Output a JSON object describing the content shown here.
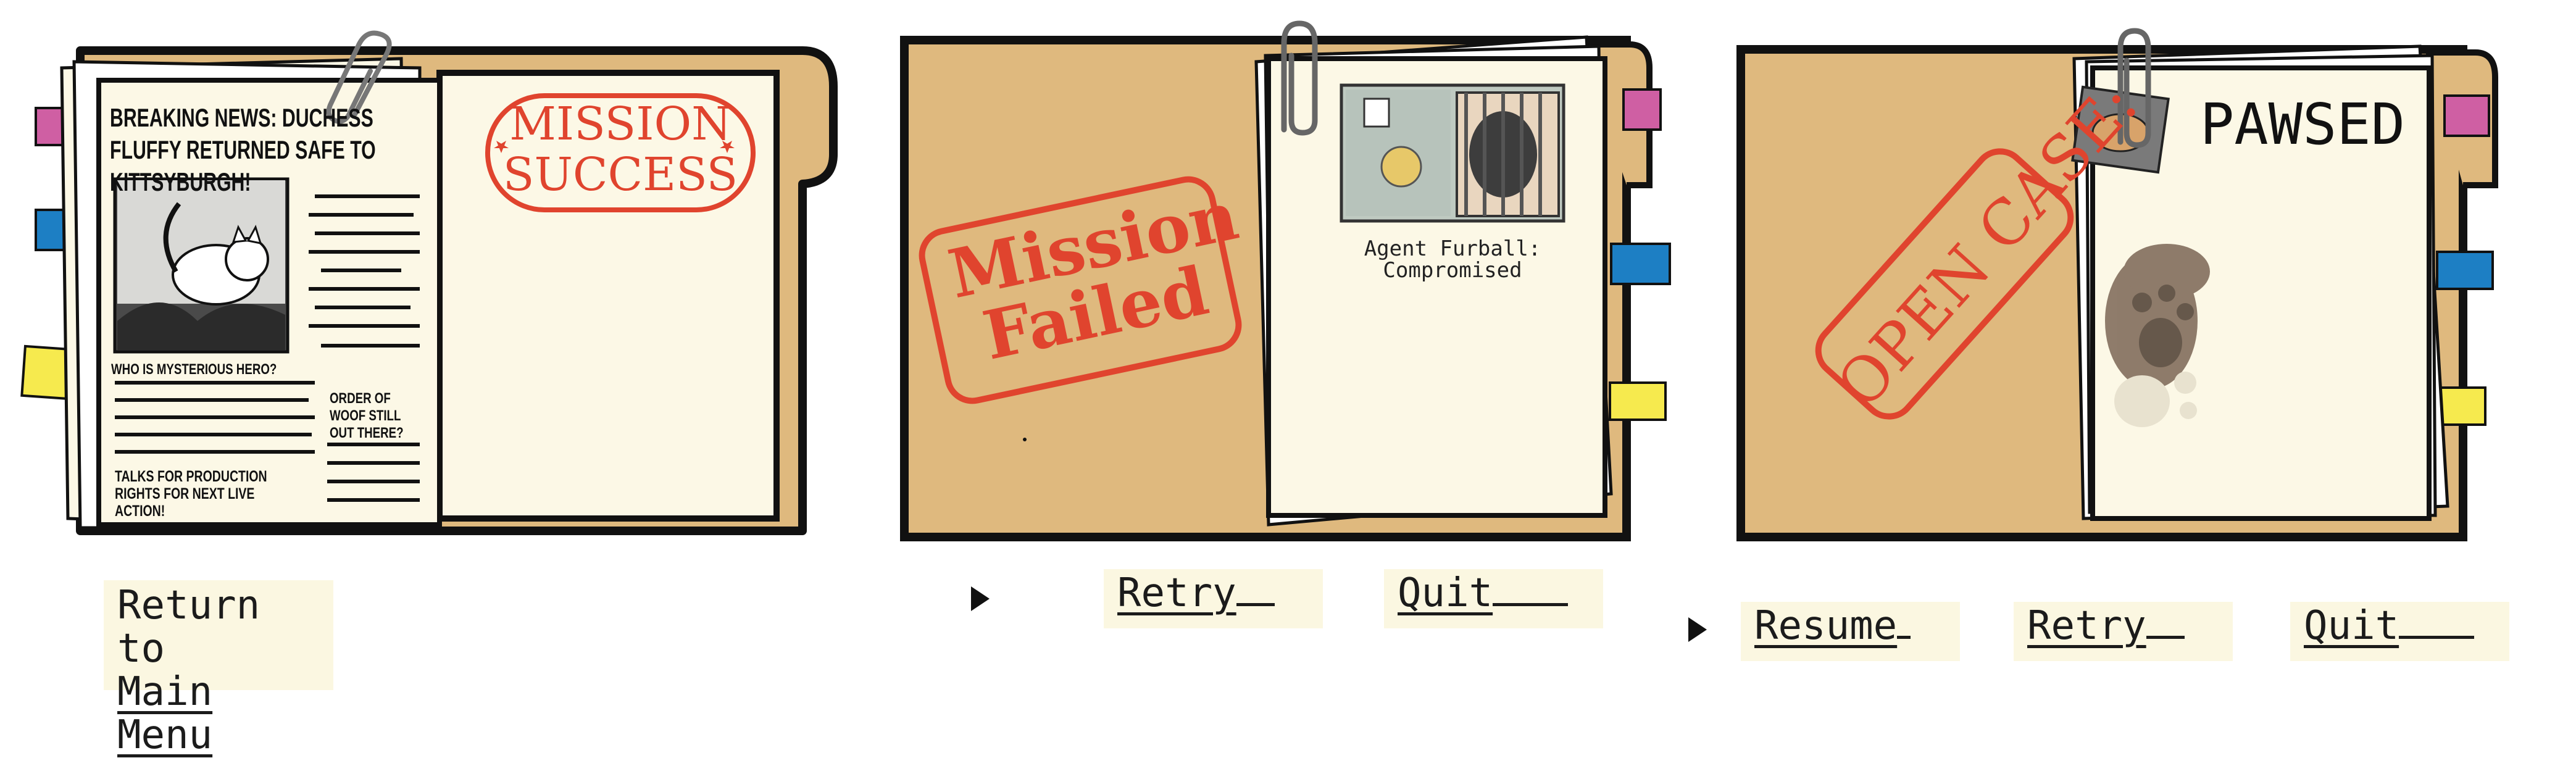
{
  "screen": {
    "success_panel": {
      "headline": "BREAKING NEWS: DUCHESS FLUFFY RETURNED SAFE TO KITTSYBURGH!",
      "sub1": "WHO IS MYSTERIOUS HERO?",
      "sub2": "ORDER OF WOOF STILL OUT THERE?",
      "sub3": "TALKS FOR PRODUCTION RIGHTS FOR NEXT LIVE ACTION!",
      "stamp_line1": "MISSION",
      "stamp_line2": "SUCCESS",
      "button_line1": "Return to",
      "button_line2": "Main Menu"
    },
    "failed_panel": {
      "stamp_line1": "Mission",
      "stamp_line2": "Failed",
      "caption_line1": "Agent Furball:",
      "caption_line2": "Compromised",
      "retry_label": "Retry",
      "quit_label": "Quit"
    },
    "paused_panel": {
      "title": "PAWSED",
      "stamp": "OPEN CASE:",
      "resume_label": "Resume",
      "retry_label": "Retry",
      "quit_label": "Quit"
    }
  },
  "colors": {
    "folder": "#dfb97e",
    "paper": "#fcf8e6",
    "stamp_red": "#e0442e",
    "tab_pink": "#cf5fa3",
    "tab_blue": "#1d7fc4",
    "tab_yellow": "#f6ea4e",
    "outline": "#111111"
  }
}
